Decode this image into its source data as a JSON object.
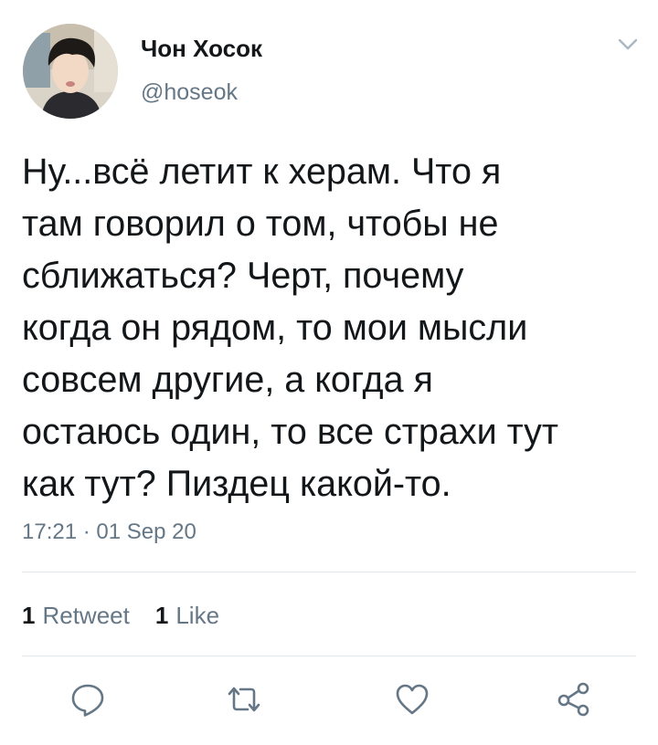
{
  "user": {
    "display_name": "Чон Хосок",
    "handle": "@hoseok"
  },
  "tweet": {
    "text_lines": [
      "Ну...всё летит к херам. Что я",
      "там говорил о том, чтобы не",
      "сближаться? Черт, почему",
      "когда он рядом, то мои мысли",
      "совсем другие, а когда я",
      "остаюсь один, то все страхи тут",
      "как тут? Пиздец какой-то."
    ],
    "timestamp": "17:21 · 01 Sep 20"
  },
  "stats": {
    "retweets_count": "1",
    "retweets_label": "Retweet",
    "likes_count": "1",
    "likes_label": "Like"
  },
  "icons": {
    "menu": "chevron-down-icon",
    "reply": "reply-icon",
    "retweet": "retweet-icon",
    "like": "heart-icon",
    "share": "share-icon"
  },
  "colors": {
    "text": "#14171a",
    "secondary": "#657786",
    "divider": "#e1e8ed",
    "icon": "#657786"
  }
}
